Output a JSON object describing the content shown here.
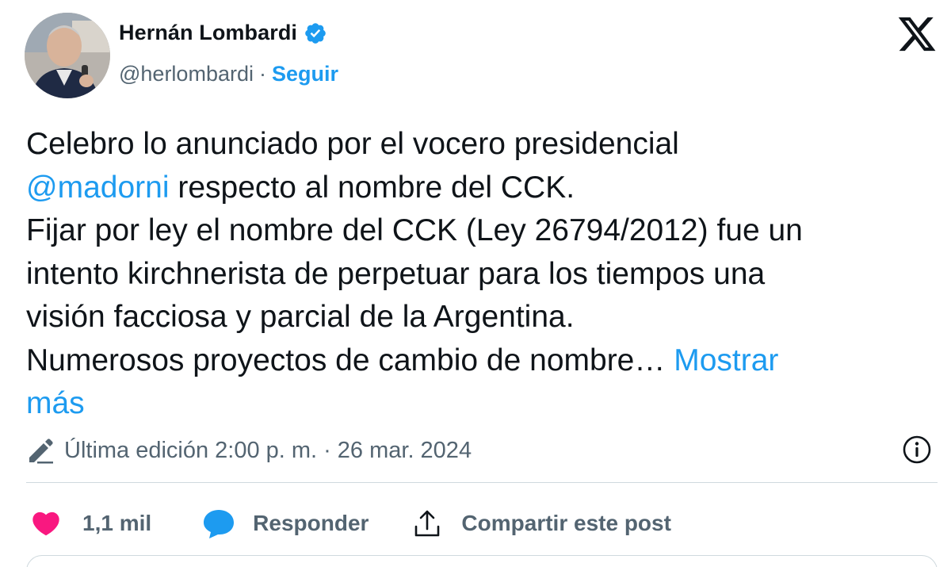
{
  "author": {
    "name": "Hernán Lombardi",
    "handle": "@herlombardi",
    "separator": "·",
    "follow_label": "Seguir",
    "verified_icon": "verified-badge-icon",
    "avatar_icon": "avatar"
  },
  "platform_logo": "x-logo-icon",
  "tweet": {
    "line1": "Celebro lo anunciado por el vocero presidencial",
    "mention": "@madorni",
    "line2_rest": " respecto al nombre del CCK.",
    "line3": "Fijar por ley el nombre del CCK (Ley 26794/2012) fue un",
    "line4": "intento kirchnerista de perpetuar para los tiempos una",
    "line5": "visión facciosa y parcial de la Argentina.",
    "line6": "Numerosos proyectos de cambio de nombre…",
    "show_more_part1": "Mostrar",
    "show_more_part2": "más"
  },
  "meta": {
    "edit_icon": "pencil-icon",
    "edit_label": "Última edición",
    "time": "2:00 p. m.",
    "separator": "·",
    "date": "26 mar. 2024",
    "info_icon": "info-icon"
  },
  "actions": {
    "like_count": "1,1 mil",
    "reply_label": "Responder",
    "share_label": "Compartir este post"
  },
  "colors": {
    "accent": "#1d9bf0",
    "like": "#f91880",
    "text": "#0f1419",
    "muted": "#536471",
    "divider": "#cfd9de"
  }
}
